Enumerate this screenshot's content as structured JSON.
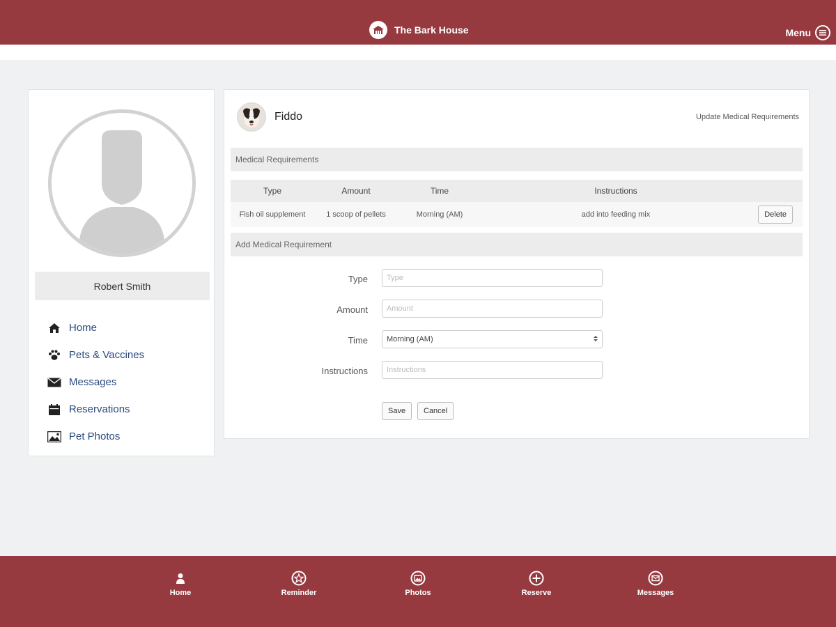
{
  "header": {
    "brand": "The Bark House",
    "menu_label": "Menu"
  },
  "user": {
    "name": "Robert Smith"
  },
  "sidebar": {
    "items": [
      {
        "label": "Home",
        "icon": "home-icon"
      },
      {
        "label": "Pets & Vaccines",
        "icon": "paw-icon"
      },
      {
        "label": "Messages",
        "icon": "envelope-icon"
      },
      {
        "label": "Reservations",
        "icon": "calendar-icon"
      },
      {
        "label": "Pet Photos",
        "icon": "photo-icon"
      }
    ]
  },
  "pet": {
    "name": "Fiddo",
    "update_link": "Update Medical Requirements"
  },
  "medical": {
    "section_title": "Medical Requirements",
    "columns": [
      "Type",
      "Amount",
      "Time",
      "Instructions"
    ],
    "rows": [
      {
        "type": "Fish oil supplement",
        "amount": "1 scoop of pellets",
        "time": "Morning (AM)",
        "instructions": "add into feeding mix",
        "action": "Delete"
      }
    ]
  },
  "form": {
    "section_title": "Add Medical Requirement",
    "type_label": "Type",
    "type_placeholder": "Type",
    "amount_label": "Amount",
    "amount_placeholder": "Amount",
    "time_label": "Time",
    "time_value": "Morning (AM)",
    "instructions_label": "Instructions",
    "instructions_placeholder": "Instructions",
    "save_label": "Save",
    "cancel_label": "Cancel"
  },
  "bottom_nav": [
    {
      "label": "Home",
      "icon": "person-icon"
    },
    {
      "label": "Reminder",
      "icon": "star-icon"
    },
    {
      "label": "Photos",
      "icon": "photos-icon"
    },
    {
      "label": "Reserve",
      "icon": "plus-icon"
    },
    {
      "label": "Messages",
      "icon": "message-icon"
    }
  ],
  "colors": {
    "brand": "#963a40",
    "link": "#2a4a7e",
    "background": "#f0f1f2"
  }
}
